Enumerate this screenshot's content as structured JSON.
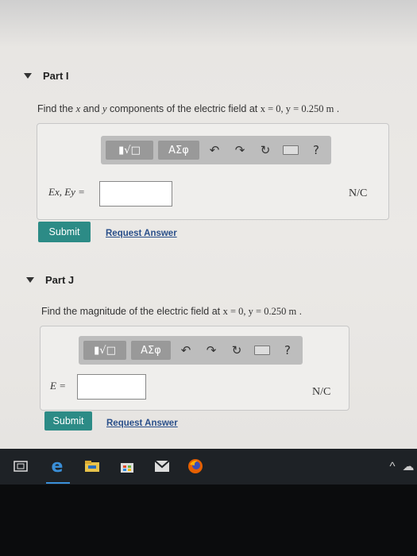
{
  "partI": {
    "title": "Part I",
    "question_prefix": "Find the ",
    "var_x": "x",
    "and": " and ",
    "var_y": "y",
    "question_mid": " components of the electric field at ",
    "condition": "x = 0, y = 0.250 m",
    "period": " .",
    "toolbar": {
      "matrix_label": "▮√□",
      "greek_label": "ΑΣφ",
      "undo_icon": "undo-icon",
      "redo_icon": "redo-icon",
      "reset_icon": "reset-icon",
      "keyboard_icon": "keyboard-icon",
      "help_label": "?"
    },
    "field_label": "Ex, Ey =",
    "field_value": "",
    "unit": "N/C",
    "submit_label": "Submit",
    "request_label": "Request Answer"
  },
  "partJ": {
    "title": "Part J",
    "question_prefix": "Find the magnitude of the electric field at ",
    "condition": "x = 0, y = 0.250 m",
    "period": " .",
    "toolbar": {
      "matrix_label": "▮√□",
      "greek_label": "ΑΣφ",
      "undo_icon": "undo-icon",
      "redo_icon": "redo-icon",
      "reset_icon": "reset-icon",
      "keyboard_icon": "keyboard-icon",
      "help_label": "?"
    },
    "field_label": "E =",
    "field_value": "",
    "unit": "N/C",
    "submit_label": "Submit",
    "request_label": "Request Answer"
  },
  "taskbar": {
    "items": [
      "task-view-icon",
      "edge-icon",
      "file-explorer-icon",
      "store-icon",
      "mail-icon",
      "firefox-icon"
    ],
    "tray": [
      "chevron-up-icon",
      "cloud-icon"
    ]
  },
  "colors": {
    "submit": "#2c8b86",
    "link": "#2a4f8a",
    "toolbar": "#bdbdbd"
  }
}
